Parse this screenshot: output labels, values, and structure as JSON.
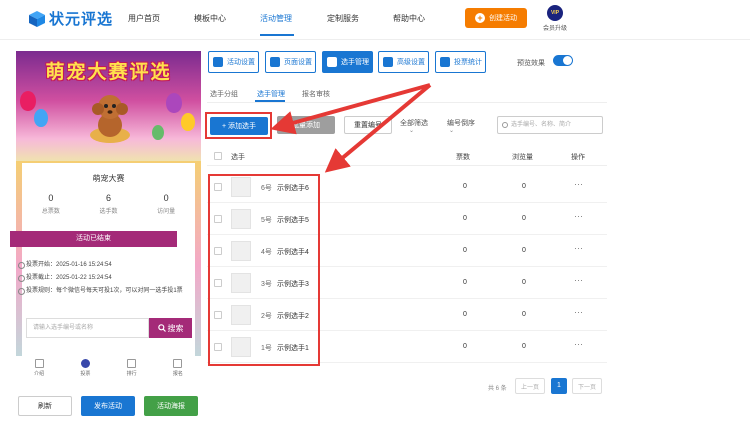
{
  "header": {
    "logo_text": "状元评选",
    "nav": [
      "用户首页",
      "模板中心",
      "活动管理",
      "定制服务",
      "帮助中心"
    ],
    "create_label": "创建活动",
    "vip_badge": "VIP",
    "vip_label": "会员升级"
  },
  "preview": {
    "banner_title": "萌宠大赛评选",
    "activity_name": "萌宠大赛",
    "stats": [
      {
        "value": "0",
        "label": "总票数"
      },
      {
        "value": "6",
        "label": "选手数"
      },
      {
        "value": "0",
        "label": "访问量"
      }
    ],
    "status": "活动已结束",
    "vote_start": "投票开始：2025-01-16 15:24:54",
    "vote_end": "投票截止：2025-01-22 15:24:54",
    "vote_rule": "投票规则：每个微信号每天可投1次，可以对同一选手投1票",
    "search_placeholder": "请输入选手编号或名称",
    "search_label": "搜索",
    "tabbar": [
      "介绍",
      "投票",
      "排行",
      "报名"
    ]
  },
  "bottom_buttons": {
    "refresh": "刷新",
    "publish": "发布活动",
    "poster": "活动海报"
  },
  "toolbar": [
    "活动设置",
    "页面设置",
    "选手管理",
    "高级设置",
    "投票统计"
  ],
  "preview_toggle_label": "预览效果",
  "subtabs": [
    "选手分组",
    "选手管理",
    "报名审核"
  ],
  "controls": {
    "add": "+ 添加选手",
    "batch": "批量添加",
    "reset": "重置编号",
    "filter_all": "全部筛选",
    "sort": "编号倒序",
    "search_placeholder": "选手编号、名称、简介"
  },
  "table": {
    "headers": [
      "选手",
      "票数",
      "浏览量",
      "操作"
    ],
    "rows": [
      {
        "no": "6号",
        "name": "示例选手6",
        "votes": "0",
        "views": "0"
      },
      {
        "no": "5号",
        "name": "示例选手5",
        "votes": "0",
        "views": "0"
      },
      {
        "no": "4号",
        "name": "示例选手4",
        "votes": "0",
        "views": "0"
      },
      {
        "no": "3号",
        "name": "示例选手3",
        "votes": "0",
        "views": "0"
      },
      {
        "no": "2号",
        "name": "示例选手2",
        "votes": "0",
        "views": "0"
      },
      {
        "no": "1号",
        "name": "示例选手1",
        "votes": "0",
        "views": "0"
      }
    ],
    "more": "···"
  },
  "pagination": {
    "total": "共 6 条",
    "prev": "上一页",
    "current": "1",
    "next": "下一页"
  },
  "colors": {
    "primary": "#1976d2",
    "accent_orange": "#f57c00",
    "highlight_red": "#e53935",
    "theme_purple": "#a42a78",
    "green": "#43a047"
  }
}
